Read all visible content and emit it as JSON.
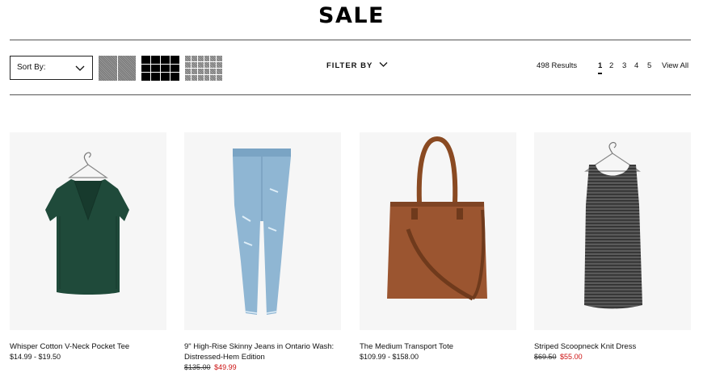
{
  "page": {
    "title": "SALE"
  },
  "toolbar": {
    "sort_label": "Sort By:",
    "filter_label": "FILTER BY",
    "results": "498 Results",
    "pages": [
      "1",
      "2",
      "3",
      "4",
      "5"
    ],
    "view_all": "View All"
  },
  "products": [
    {
      "name": "Whisper Cotton V-Neck Pocket Tee",
      "price": "$14.99 - $19.50",
      "image": "green-tee"
    },
    {
      "name": "9\" High-Rise Skinny Jeans in Ontario Wash: Distressed-Hem Edition",
      "price_was": "$135.00",
      "price_now": "$49.99",
      "image": "light-wash-jeans"
    },
    {
      "name": "The Medium Transport Tote",
      "price": "$109.99 - $158.00",
      "image": "brown-leather-tote"
    },
    {
      "name": "Striped Scoopneck Knit Dress",
      "price_was": "$69.50",
      "price_now": "$55.00",
      "image": "striped-tank-dress"
    }
  ],
  "colors": {
    "sale_price": "#cc1111",
    "rule": "#555555",
    "image_bg": "#f6f6f6"
  }
}
